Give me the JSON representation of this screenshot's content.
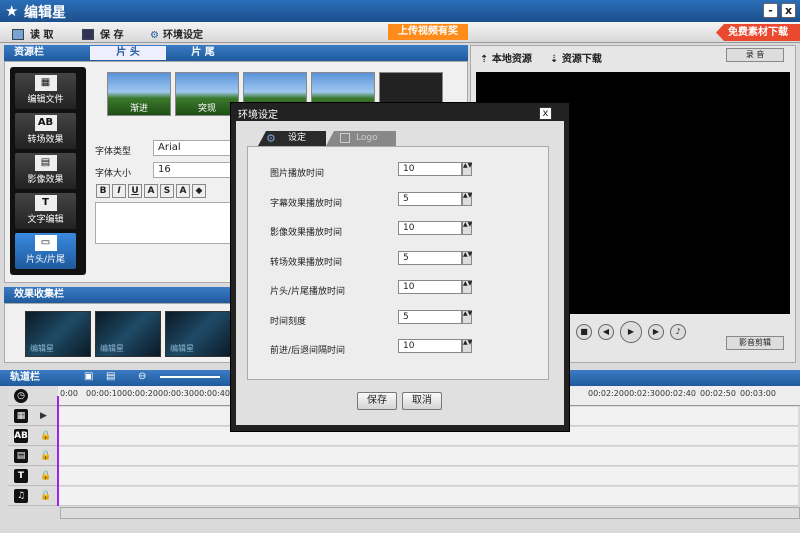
{
  "app": {
    "title": "编辑星",
    "min": "-",
    "close": "x"
  },
  "toolbar": {
    "read": "读 取",
    "save": "保 存",
    "settings": "环境设定",
    "upload": "上传视频有奖",
    "free_download": "免费素材下载"
  },
  "resource": {
    "header": "资源栏",
    "tab_head": "片 头",
    "tab_tail": "片 尾",
    "menu": [
      "编辑文件",
      "转场效果",
      "影像效果",
      "文字编辑",
      "片头/片尾"
    ],
    "menu_icons": [
      "AB",
      "T"
    ],
    "thumbs": [
      "渐进",
      "突现"
    ],
    "font_type_label": "字体类型",
    "font_type_value": "Arial",
    "font_size_label": "字体大小",
    "font_size_value": "16",
    "fmt": [
      "B",
      "I",
      "U",
      "A",
      "S",
      "A"
    ]
  },
  "effects": {
    "header": "效果收集栏",
    "items": [
      "编辑星",
      "编辑星",
      "编辑星"
    ]
  },
  "right": {
    "local": "本地资源",
    "download": "资源下载",
    "record": "录 音",
    "snapshot": "影音剪辑"
  },
  "track": {
    "header": "轨道栏",
    "ticks": [
      "0:00",
      "00:00:10",
      "00:00:20",
      "00:00:30",
      "00:00:40",
      "00:02:20",
      "00:02:30",
      "00:02:40",
      "00:02:50",
      "00:03:00"
    ],
    "icons": [
      "AB",
      "T"
    ]
  },
  "dialog": {
    "title": "环境设定",
    "close": "x",
    "tab_settings": "设定",
    "tab_logo": "Logo",
    "rows": [
      {
        "label": "图片播放时间",
        "value": "10"
      },
      {
        "label": "字幕效果播放时间",
        "value": "5"
      },
      {
        "label": "影像效果播放时间",
        "value": "10"
      },
      {
        "label": "转场效果播放时间",
        "value": "5"
      },
      {
        "label": "片头/片尾播放时间",
        "value": "10"
      },
      {
        "label": "时间刻度",
        "value": "5"
      },
      {
        "label": "前进/后退间隔时间",
        "value": "10"
      }
    ],
    "save": "保存",
    "cancel": "取消"
  },
  "colors": {
    "accent": "#1f5a9c",
    "upload": "#ff8c1a",
    "free": "#e9492f",
    "cursor": "#a020f0"
  }
}
